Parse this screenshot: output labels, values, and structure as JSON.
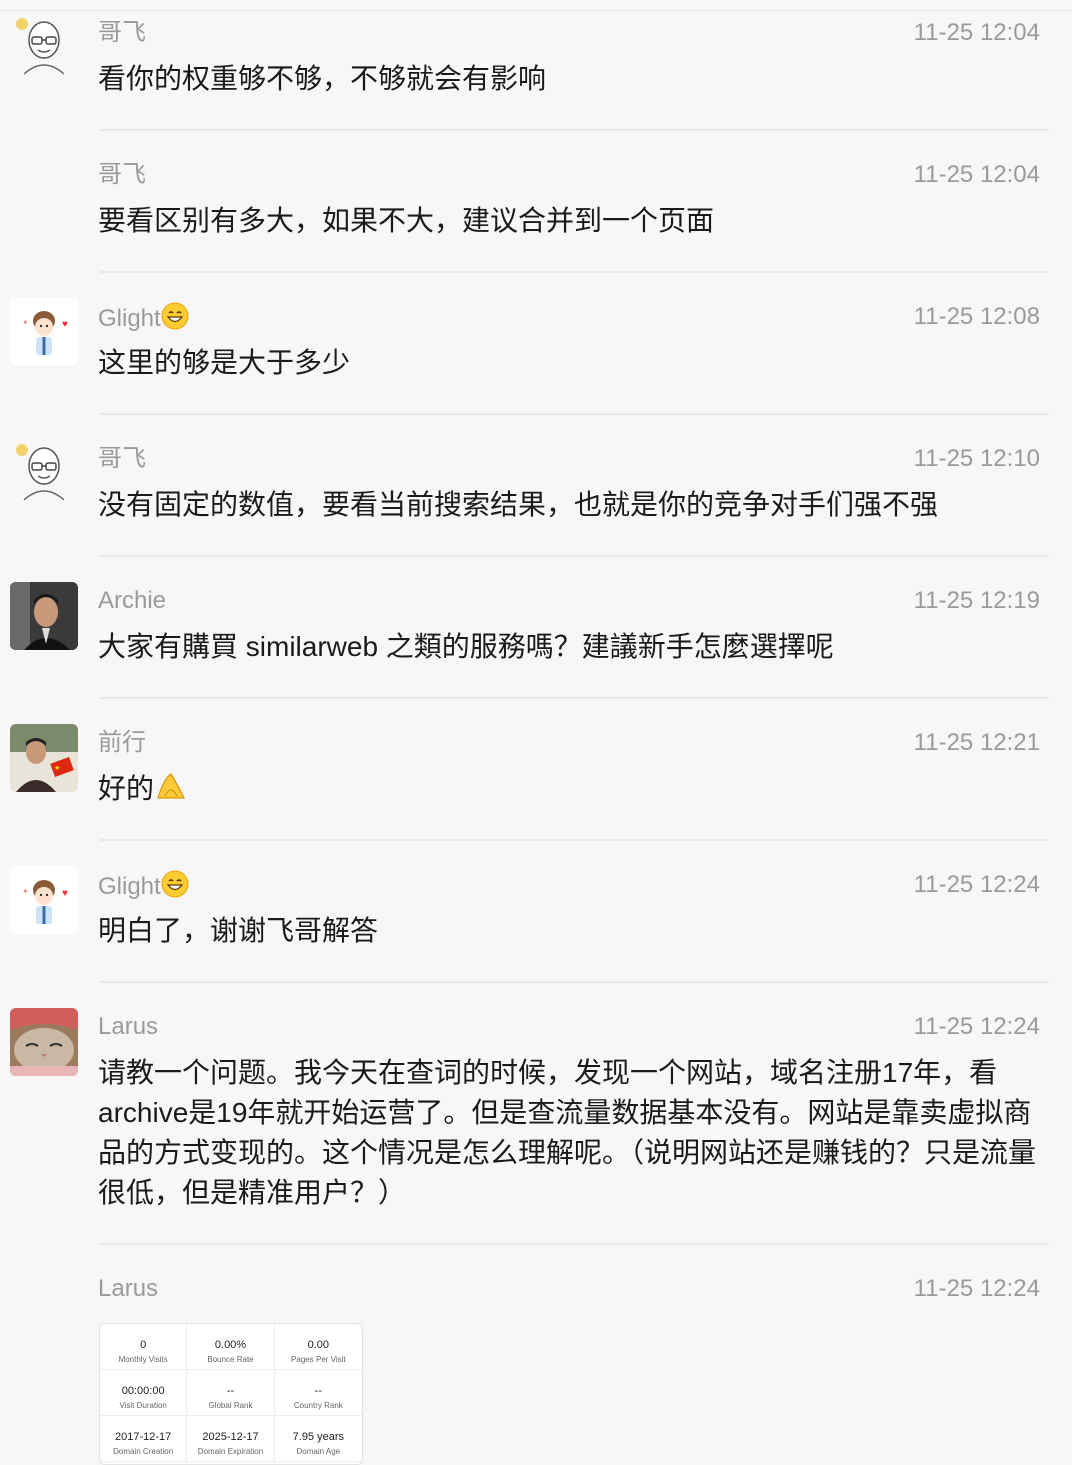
{
  "messages": [
    {
      "name": "哥飞",
      "time": "11-25 12:04",
      "text": "看你的权重够不够，不够就会有影响",
      "avatar": "bald-glasses-avatar"
    },
    {
      "name": "哥飞",
      "time": "11-25 12:04",
      "text": "要看区别有多大，如果不大，建议合并到一个页面",
      "avatar": ""
    },
    {
      "name": "Glight",
      "time": "11-25 12:08",
      "text": "这里的够是大于多少",
      "avatar": "cartoon-boy-avatar"
    },
    {
      "name": "哥飞",
      "time": "11-25 12:10",
      "text": "没有固定的数值，要看当前搜索结果，也就是你的竞争对手们强不强",
      "avatar": "bald-glasses-avatar"
    },
    {
      "name": "Archie",
      "time": "11-25 12:19",
      "text": "大家有購買 similarweb 之類的服務嗎？建議新手怎麼選擇呢",
      "avatar": "photo-avatar"
    },
    {
      "name": "前行",
      "time": "11-25 12:21",
      "text": "好的",
      "avatar": "photo-flag-avatar"
    },
    {
      "name": "Glight",
      "time": "11-25 12:24",
      "text": "明白了，谢谢飞哥解答",
      "avatar": "cartoon-boy-avatar"
    },
    {
      "name": "Larus",
      "time": "11-25 12:24",
      "text": "请教一个问题。我今天在查词的时候，发现一个网站，域名注册17年，看archive是19年就开始运营了。但是查流量数据基本没有。网站是靠卖虚拟商品的方式变现的。这个情况是怎么理解呢。（说明网站还是赚钱的？只是流量很低，但是精准用户？）",
      "avatar": "cat-avatar"
    },
    {
      "name": "Larus",
      "time": "11-25 12:24",
      "text": "",
      "avatar": ""
    }
  ],
  "stats_card": {
    "cells": [
      {
        "value": "0",
        "label": "Monthly Visits"
      },
      {
        "value": "0.00%",
        "label": "Bounce Rate"
      },
      {
        "value": "0.00",
        "label": "Pages Per Visit"
      },
      {
        "value": "00:00:00",
        "label": "Visit Duration"
      },
      {
        "value": "--",
        "label": "Global Rank"
      },
      {
        "value": "--",
        "label": "Country Rank"
      },
      {
        "value": "2017-12-17",
        "label": "Domain Creation"
      },
      {
        "value": "2025-12-17",
        "label": "Domain Expiration"
      },
      {
        "value": "7.95 years",
        "label": "Domain Age"
      }
    ]
  },
  "icons": {
    "grin-emoji": "grinning-face-emoji",
    "ok-hand-emoji": "pinched-hand-emoji"
  },
  "colors": {
    "background": "#f7f7f7",
    "name": "#9a9a9a",
    "text": "#1a1a1a",
    "separator": "#e8e8e8"
  }
}
